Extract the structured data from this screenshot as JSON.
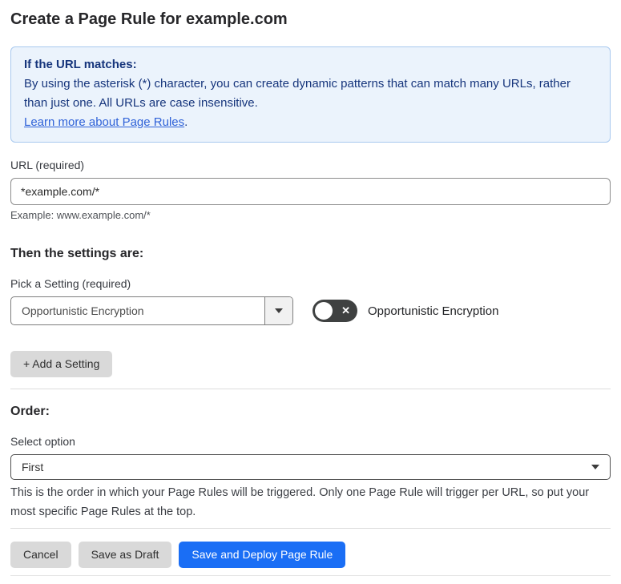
{
  "page": {
    "title": "Create a Page Rule for example.com"
  },
  "info_box": {
    "heading": "If the URL matches:",
    "body": "By using the asterisk (*) character, you can create dynamic patterns that can match many URLs, rather than just one. All URLs are case insensitive.",
    "link_label": "Learn more about Page Rules",
    "link_suffix": "."
  },
  "url_field": {
    "label": "URL (required)",
    "value": "*example.com/*",
    "helper": "Example: www.example.com/*"
  },
  "settings": {
    "heading": "Then the settings are:",
    "picker_label": "Pick a Setting (required)",
    "selected_setting": "Opportunistic Encryption",
    "toggle": {
      "label": "Opportunistic Encryption",
      "state": "off",
      "glyph": "✕"
    },
    "add_button_label": "+ Add a Setting"
  },
  "order": {
    "heading": "Order:",
    "select_label": "Select option",
    "selected_option": "First",
    "help": "This is the order in which your Page Rules will be triggered. Only one Page Rule will trigger per URL, so put your most specific Page Rules at the top."
  },
  "footer": {
    "cancel_label": "Cancel",
    "save_draft_label": "Save as Draft",
    "save_deploy_label": "Save and Deploy Page Rule"
  },
  "colors": {
    "accent_blue": "#1a6ef5",
    "info_bg": "#ebf3fc",
    "info_border": "#a9c9ef",
    "info_text": "#16357c",
    "link_blue": "#2f62d8",
    "toggle_off_bg": "#3f4141",
    "button_gray": "#d9d9d9"
  }
}
